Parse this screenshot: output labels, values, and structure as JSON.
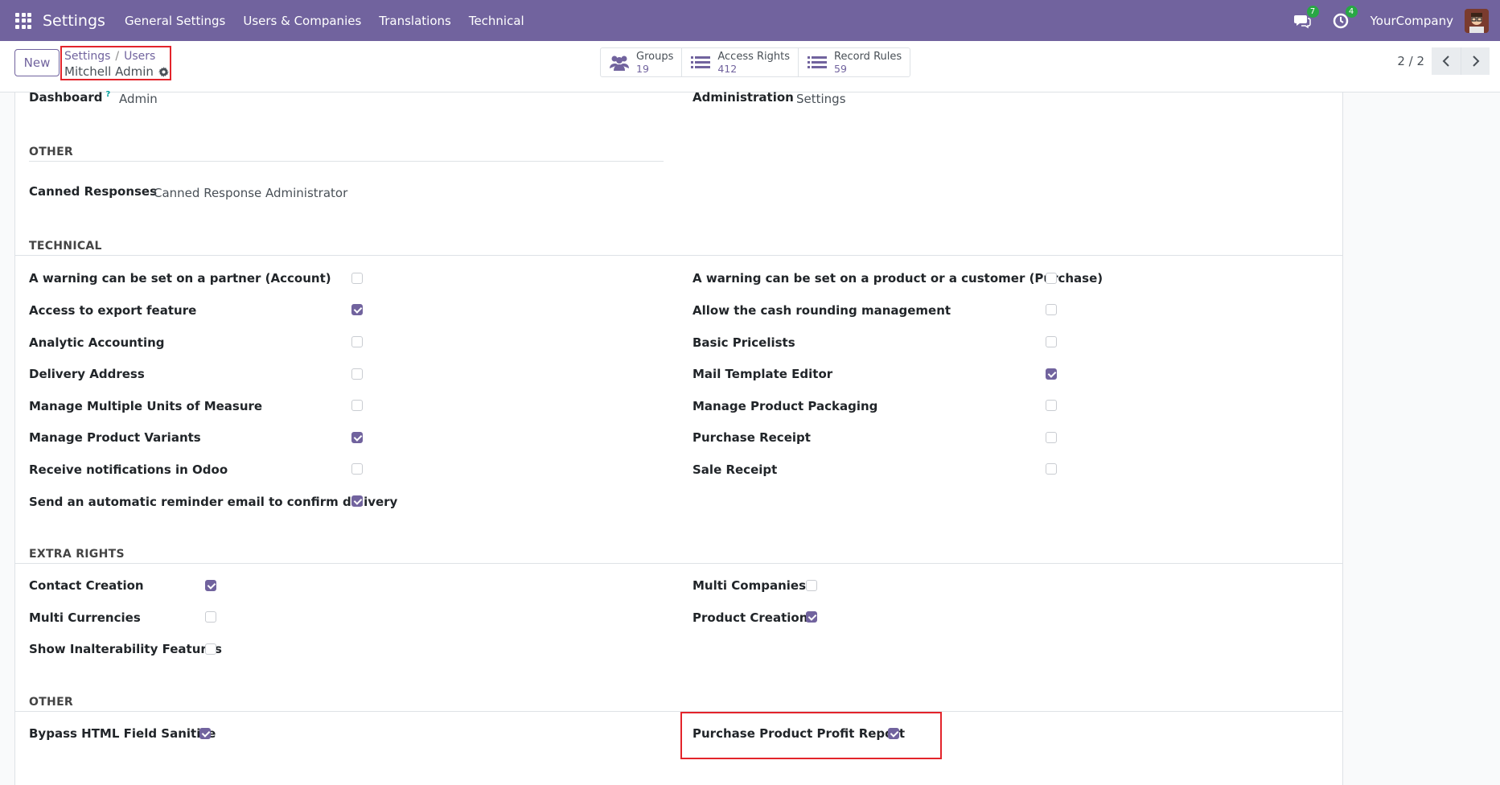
{
  "navbar": {
    "app_title": "Settings",
    "menu": [
      "General Settings",
      "Users & Companies",
      "Translations",
      "Technical"
    ],
    "messages_count": "7",
    "activities_count": "4",
    "company": "YourCompany",
    "icons": [
      "apps-grid-icon",
      "chat-icon",
      "clock-icon",
      "user-avatar"
    ]
  },
  "control": {
    "new_label": "New",
    "breadcrumb": [
      "Settings",
      "Users"
    ],
    "record_name": "Mitchell Admin",
    "smart_buttons": [
      {
        "label": "Groups",
        "value": "19",
        "icon": "users-icon"
      },
      {
        "label": "Access Rights",
        "value": "412",
        "icon": "list-icon"
      },
      {
        "label": "Record Rules",
        "value": "59",
        "icon": "list-icon"
      }
    ],
    "pager": "2 / 2"
  },
  "form": {
    "top_left_label": "Dashboard",
    "top_left_sup": "?",
    "top_left_value": "Admin",
    "top_right_label": "Administration",
    "top_right_value": "Settings",
    "other_section": "OTHER",
    "canned_label": "Canned Responses",
    "canned_value": "Canned Response Administrator",
    "technical_section": "TECHNICAL",
    "technical_left": [
      {
        "label": "A warning can be set on a partner (Account)",
        "checked": false
      },
      {
        "label": "Access to export feature",
        "checked": true
      },
      {
        "label": "Analytic Accounting",
        "checked": false
      },
      {
        "label": "Delivery Address",
        "checked": false
      },
      {
        "label": "Manage Multiple Units of Measure",
        "checked": false
      },
      {
        "label": "Manage Product Variants",
        "checked": true
      },
      {
        "label": "Receive notifications in Odoo",
        "checked": false
      },
      {
        "label": "Send an automatic reminder email to confirm delivery",
        "checked": true
      }
    ],
    "technical_right": [
      {
        "label": "A warning can be set on a product or a customer (Purchase)",
        "checked": false
      },
      {
        "label": "Allow the cash rounding management",
        "checked": false
      },
      {
        "label": "Basic Pricelists",
        "checked": false
      },
      {
        "label": "Mail Template Editor",
        "checked": true
      },
      {
        "label": "Manage Product Packaging",
        "checked": false
      },
      {
        "label": "Purchase Receipt",
        "checked": false
      },
      {
        "label": "Sale Receipt",
        "checked": false
      }
    ],
    "extra_section": "EXTRA RIGHTS",
    "extra_left": [
      {
        "label": "Contact Creation",
        "checked": true
      },
      {
        "label": "Multi Currencies",
        "checked": false
      },
      {
        "label": "Show Inalterability Features",
        "checked": false
      }
    ],
    "extra_right": [
      {
        "label": "Multi Companies",
        "checked": false
      },
      {
        "label": "Product Creation",
        "checked": true
      }
    ],
    "other2_section": "OTHER",
    "other2_left": {
      "label": "Bypass HTML Field Sanitize",
      "checked": true
    },
    "other2_right": {
      "label": "Purchase Product Profit Report",
      "checked": true
    }
  },
  "colors": {
    "brand": "#71639e",
    "highlight": "#e3242b",
    "badge": "#28a745"
  }
}
